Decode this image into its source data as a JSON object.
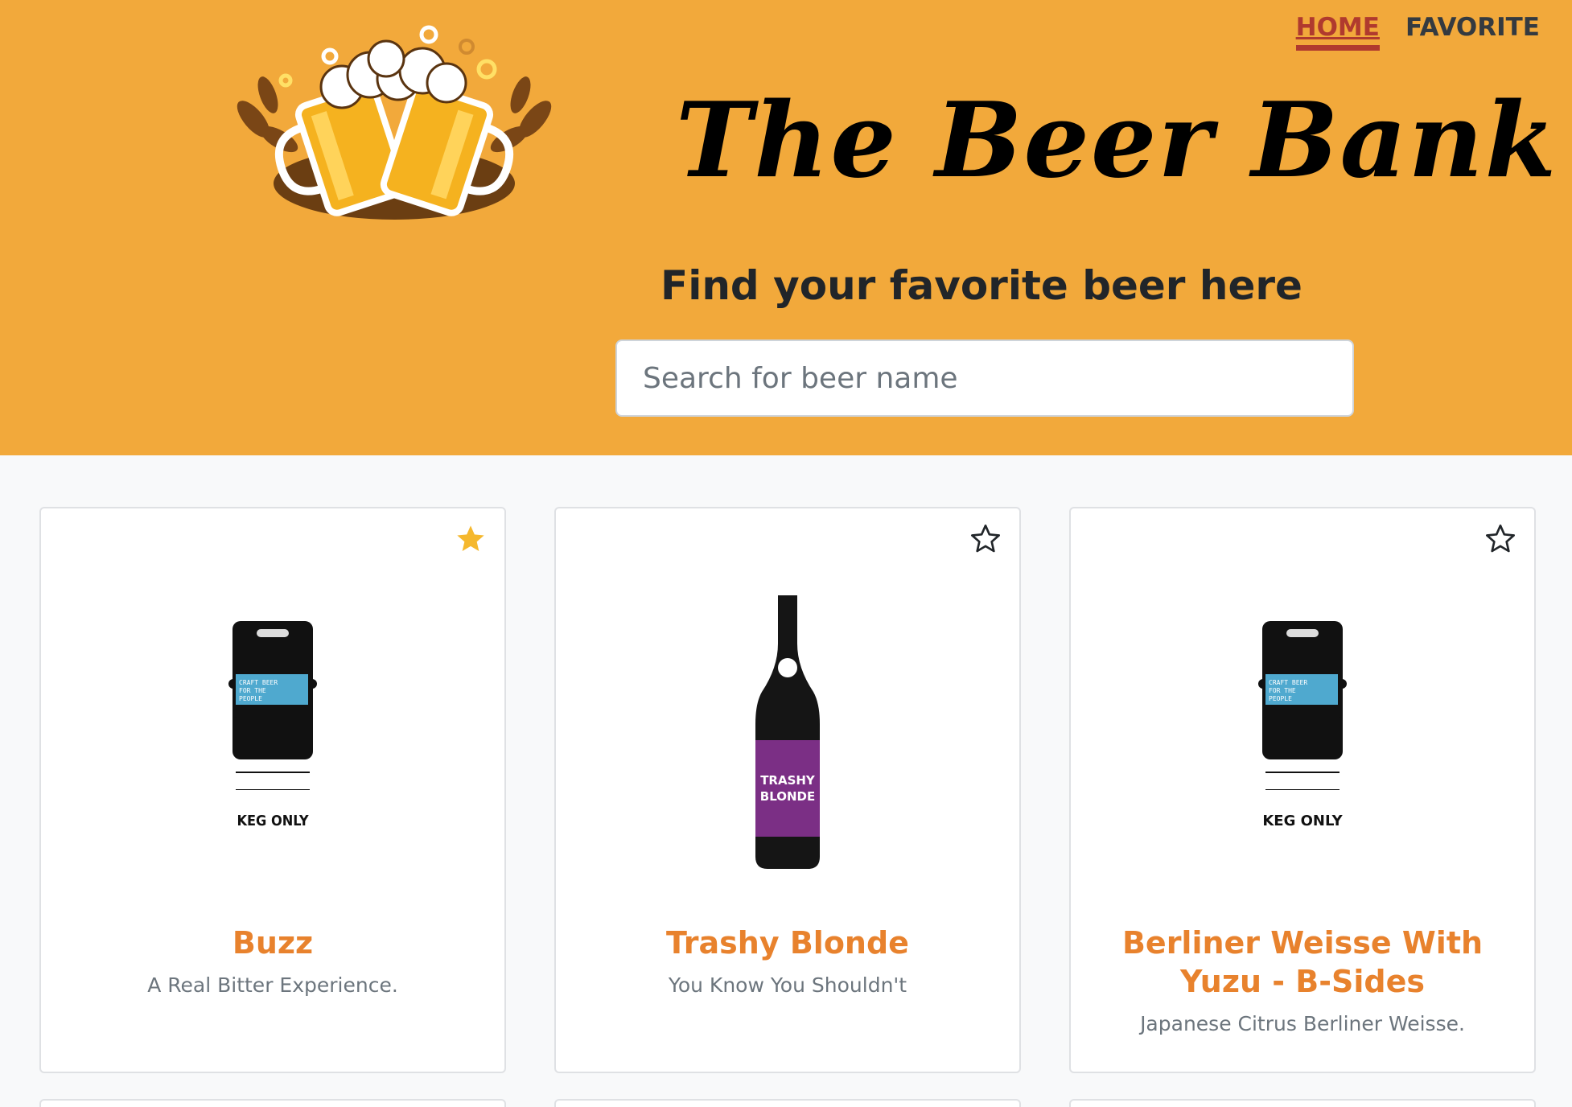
{
  "nav": {
    "home": "HOME",
    "favorite": "FAVORITE"
  },
  "header": {
    "title": "The Beer Bank",
    "tagline": "Find your favorite beer here",
    "search_placeholder": "Search for beer name",
    "search_value": ""
  },
  "colors": {
    "header_bg": "#f2a93b",
    "accent": "#e8822d",
    "nav_active": "#b03a2e",
    "star_active": "#f5b82e"
  },
  "beers": [
    {
      "name": "Buzz",
      "tagline": "A Real Bitter Experience.",
      "favorited": true,
      "image": "keg",
      "keg_label": "KEG ONLY",
      "keg_band": "CRAFT BEER FOR THE PEOPLE"
    },
    {
      "name": "Trashy Blonde",
      "tagline": "You Know You Shouldn't",
      "favorited": false,
      "image": "bottle",
      "bottle_label": "TRASHY BLONDE"
    },
    {
      "name": "Berliner Weisse With Yuzu - B-Sides",
      "tagline": "Japanese Citrus Berliner Weisse.",
      "favorited": false,
      "image": "keg",
      "keg_label": "KEG ONLY",
      "keg_band": "CRAFT BEER FOR THE PEOPLE"
    }
  ]
}
